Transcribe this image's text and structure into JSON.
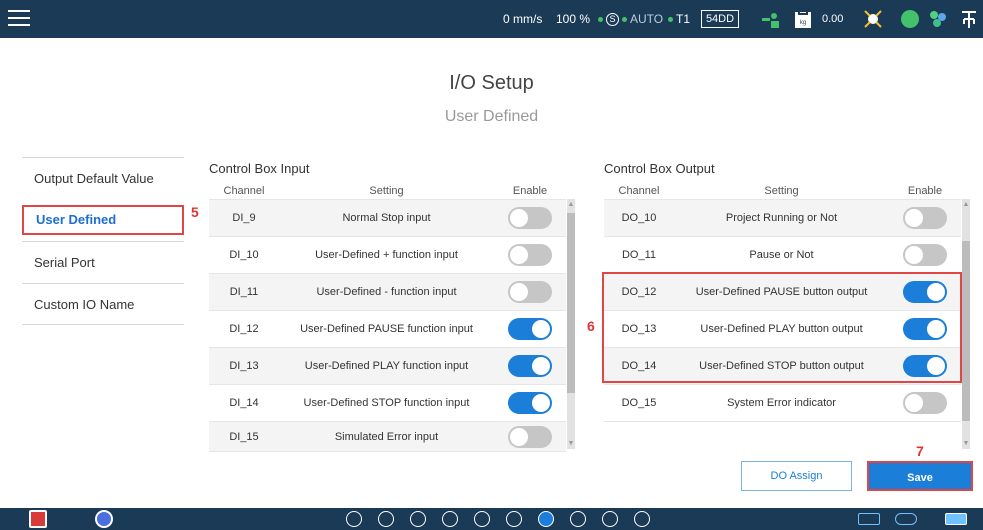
{
  "status": {
    "speed": "0 mm/s",
    "percent": "100 %",
    "mode": "AUTO",
    "t1": "T1",
    "id": "54DD",
    "weight": "0.00"
  },
  "page": {
    "title": "I/O Setup",
    "subtitle": "User Defined"
  },
  "sidebar": {
    "items": [
      {
        "label": "Output Default Value"
      },
      {
        "label": "User Defined"
      },
      {
        "label": "Serial Port"
      },
      {
        "label": "Custom IO Name"
      }
    ]
  },
  "markers": {
    "m5": "5",
    "m6": "6",
    "m7": "7"
  },
  "input": {
    "title": "Control Box Input",
    "headers": {
      "channel": "Channel",
      "setting": "Setting",
      "enable": "Enable"
    },
    "rows": [
      {
        "channel": "DI_9",
        "setting": "Normal Stop input",
        "enabled": false
      },
      {
        "channel": "DI_10",
        "setting": "User-Defined + function input",
        "enabled": false
      },
      {
        "channel": "DI_11",
        "setting": "User-Defined - function input",
        "enabled": false
      },
      {
        "channel": "DI_12",
        "setting": "User-Defined PAUSE function input",
        "enabled": true
      },
      {
        "channel": "DI_13",
        "setting": "User-Defined PLAY function input",
        "enabled": true
      },
      {
        "channel": "DI_14",
        "setting": "User-Defined STOP function input",
        "enabled": true
      },
      {
        "channel": "DI_15",
        "setting": "Simulated Error input",
        "enabled": false
      }
    ]
  },
  "output": {
    "title": "Control Box Output",
    "headers": {
      "channel": "Channel",
      "setting": "Setting",
      "enable": "Enable"
    },
    "rows": [
      {
        "channel": "DO_10",
        "setting": "Project Running or Not",
        "enabled": false
      },
      {
        "channel": "DO_11",
        "setting": "Pause or Not",
        "enabled": false
      },
      {
        "channel": "DO_12",
        "setting": "User-Defined PAUSE button output",
        "enabled": true
      },
      {
        "channel": "DO_13",
        "setting": "User-Defined PLAY button output",
        "enabled": true
      },
      {
        "channel": "DO_14",
        "setting": "User-Defined STOP button output",
        "enabled": true
      },
      {
        "channel": "DO_15",
        "setting": "System Error indicator",
        "enabled": false
      }
    ]
  },
  "buttons": {
    "do_assign": "DO Assign",
    "save": "Save"
  },
  "colors": {
    "accent": "#1b7ed8",
    "topbar": "#1b3a55",
    "highlight": "#e04646"
  }
}
